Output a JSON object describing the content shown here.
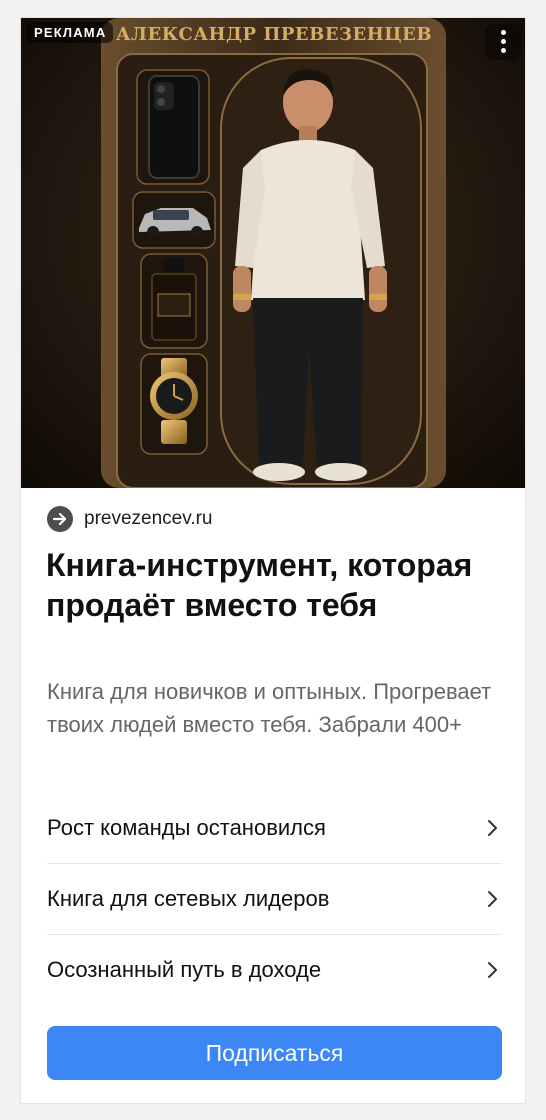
{
  "ad": {
    "badge": "РЕКЛАМА",
    "hero_title": "АЛЕКСАНДР ПРЕВЕЗЕНЦЕВ",
    "domain": "prevezencev.ru",
    "domain_icon": "arrow-right-circle-icon",
    "menu_icon": "more-vertical-icon",
    "headline": "Книга-инструмент, которая продаёт вместо тебя",
    "description": "Книга для новичков и оптыных. Прогревает твоих людей вместо тебя. Забрали 400+",
    "links": [
      {
        "label": "Рост команды остановился",
        "icon": "chevron-right-icon"
      },
      {
        "label": "Книга для сетевых лидеров",
        "icon": "chevron-right-icon"
      },
      {
        "label": "Осознанный путь в доходе",
        "icon": "chevron-right-icon"
      }
    ],
    "cta": "Подписаться"
  },
  "colors": {
    "accent": "#3d86f5",
    "hero_gold": "#d6ad64",
    "hero_background": "#1a130d"
  }
}
